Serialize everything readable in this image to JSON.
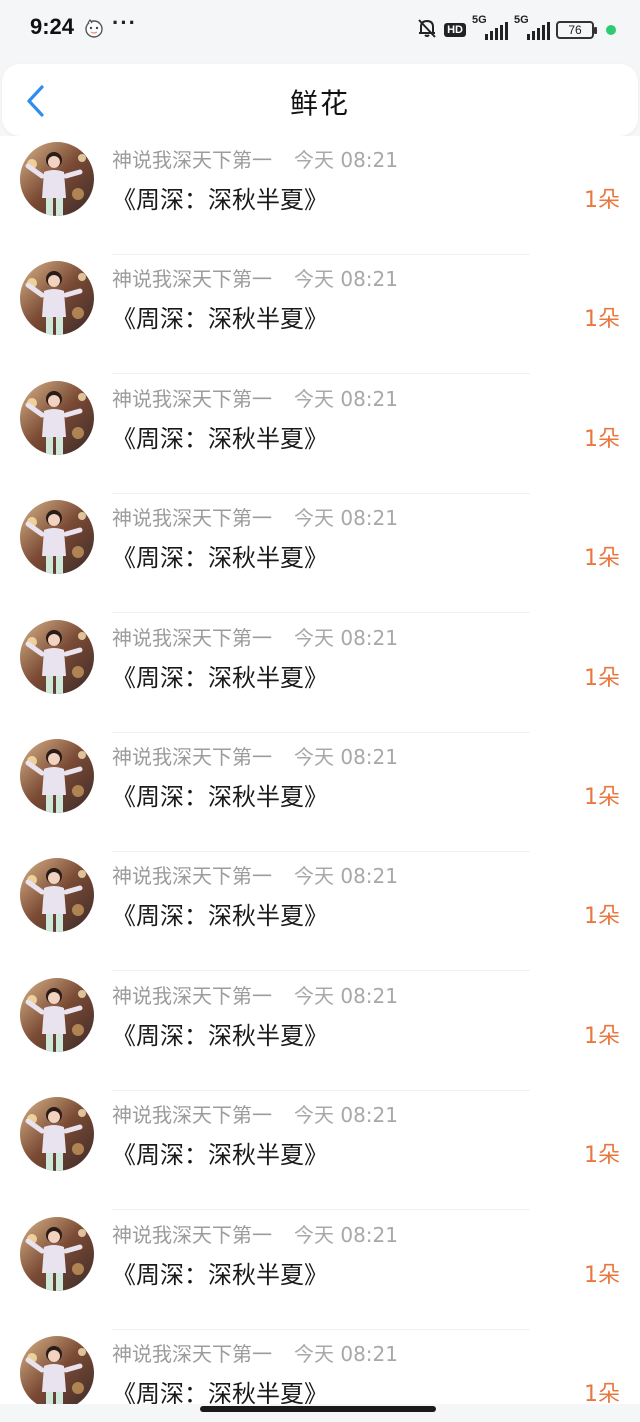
{
  "status_bar": {
    "time": "9:24",
    "more": "···",
    "hd": "HD",
    "net1": "5G",
    "net2": "5G",
    "battery": "76",
    "icons": [
      "notification-icon",
      "mute-bell-icon",
      "signal-icon",
      "battery-icon"
    ]
  },
  "header": {
    "title": "鲜花",
    "back_icon": "chevron-left-icon"
  },
  "items": [
    {
      "name": "神说我深天下第一",
      "time": "今天 08:21",
      "title": "《周深：深秋半夏》",
      "count": "1朵"
    },
    {
      "name": "神说我深天下第一",
      "time": "今天 08:21",
      "title": "《周深：深秋半夏》",
      "count": "1朵"
    },
    {
      "name": "神说我深天下第一",
      "time": "今天 08:21",
      "title": "《周深：深秋半夏》",
      "count": "1朵"
    },
    {
      "name": "神说我深天下第一",
      "time": "今天 08:21",
      "title": "《周深：深秋半夏》",
      "count": "1朵"
    },
    {
      "name": "神说我深天下第一",
      "time": "今天 08:21",
      "title": "《周深：深秋半夏》",
      "count": "1朵"
    },
    {
      "name": "神说我深天下第一",
      "time": "今天 08:21",
      "title": "《周深：深秋半夏》",
      "count": "1朵"
    },
    {
      "name": "神说我深天下第一",
      "time": "今天 08:21",
      "title": "《周深：深秋半夏》",
      "count": "1朵"
    },
    {
      "name": "神说我深天下第一",
      "time": "今天 08:21",
      "title": "《周深：深秋半夏》",
      "count": "1朵"
    },
    {
      "name": "神说我深天下第一",
      "time": "今天 08:21",
      "title": "《周深：深秋半夏》",
      "count": "1朵"
    },
    {
      "name": "神说我深天下第一",
      "time": "今天 08:21",
      "title": "《周深：深秋半夏》",
      "count": "1朵"
    },
    {
      "name": "神说我深天下第一",
      "time": "今天 08:21",
      "title": "《周深：深秋半夏》",
      "count": "1朵"
    }
  ],
  "colors": {
    "accent": "#2f8cf0",
    "count": "#e9773e",
    "subtext": "#9c9c9c"
  }
}
